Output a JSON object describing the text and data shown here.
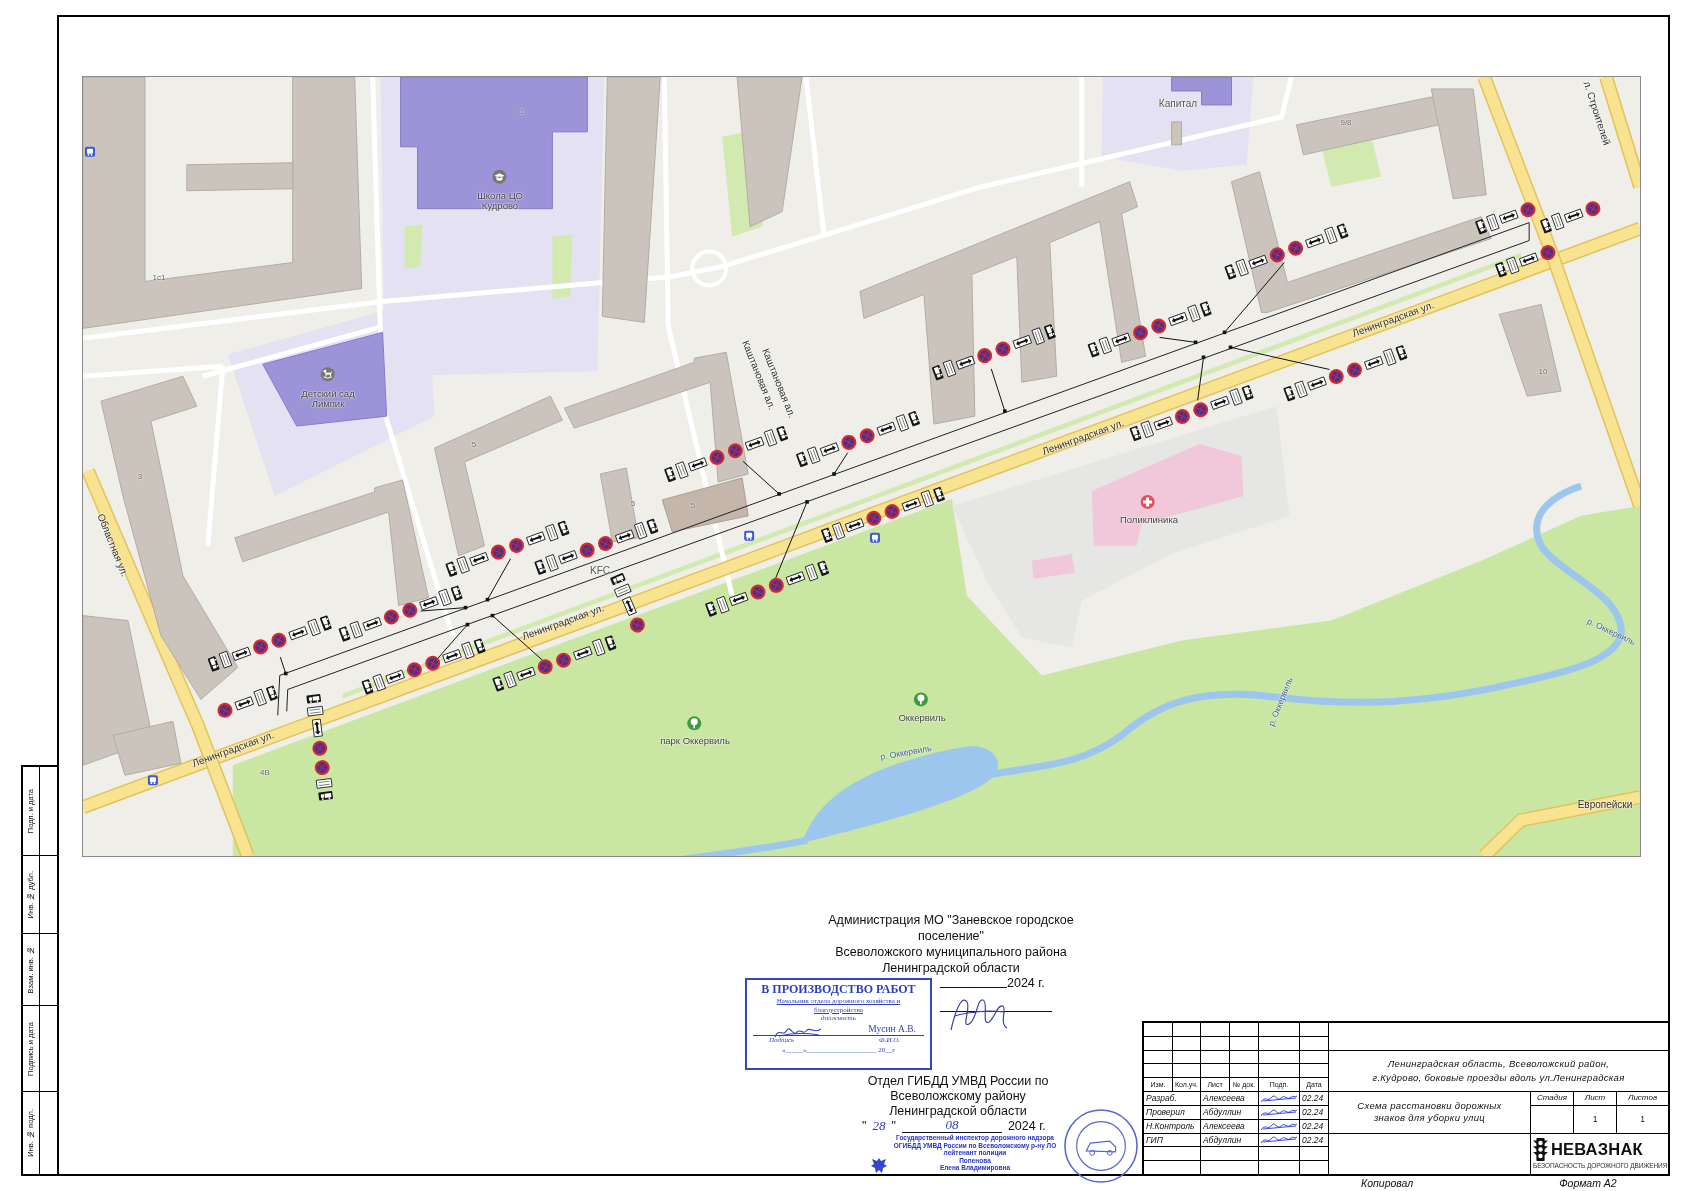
{
  "side_stamp": [
    "Подп. и дата",
    "Инв. № дубл.",
    "Взам. инв. №",
    "Подпись и дата",
    "Инв. № подл."
  ],
  "map": {
    "labels": [
      {
        "kind": "place",
        "text": "Капитал"
      },
      {
        "kind": "number",
        "text": "9/8"
      },
      {
        "kind": "street",
        "text": "л. Строителей"
      },
      {
        "kind": "number",
        "text": "1"
      },
      {
        "kind": "poi",
        "text": "Школа ЦО Кудрово"
      },
      {
        "kind": "number",
        "text": "1с1"
      },
      {
        "kind": "street",
        "text": "Ленинградская ул."
      },
      {
        "kind": "poi",
        "text": "Детский сад Лимпик"
      },
      {
        "kind": "number",
        "text": "10"
      },
      {
        "kind": "street",
        "text": "Каштановая ал."
      },
      {
        "kind": "street",
        "text": "Каштановая ал."
      },
      {
        "kind": "street",
        "text": "Ленинградская ул."
      },
      {
        "kind": "number",
        "text": "5"
      },
      {
        "kind": "number",
        "text": "3"
      },
      {
        "kind": "number",
        "text": "5"
      },
      {
        "kind": "number",
        "text": "5"
      },
      {
        "kind": "poi",
        "text": "Поликлиника"
      },
      {
        "kind": "street",
        "text": "Областная ул."
      },
      {
        "kind": "place",
        "text": "KFC"
      },
      {
        "kind": "street",
        "text": "Ленинградская ул."
      },
      {
        "kind": "water",
        "text": "р. Оккервиль"
      },
      {
        "kind": "water",
        "text": "р. Оккервиль"
      },
      {
        "kind": "poi",
        "text": "Оккервиль"
      },
      {
        "kind": "poi",
        "text": "парк Оккервиль"
      },
      {
        "kind": "water",
        "text": "р. Оккервиль"
      },
      {
        "kind": "street",
        "text": "Ленинградская ул."
      },
      {
        "kind": "number",
        "text": "4В"
      },
      {
        "kind": "street",
        "text": "Европейски"
      }
    ]
  },
  "approvals": {
    "administration": {
      "lines": [
        "Администрация МО \"Заневское городское",
        "поселение\"",
        "Всеволожского муниципального района",
        "Ленинградской области"
      ],
      "year": "2024 г."
    },
    "work_stamp": {
      "title": "В ПРОИЗВОДСТВО РАБОТ",
      "position_lines": [
        "Начальник отдела дорожного хозяйства и",
        "благоустройства"
      ],
      "position_caption": "должность",
      "name": "Мусин А.В.",
      "signature_caption": "Подпись",
      "name_caption": "Ф.И.О.",
      "date_line": "«_____»____________________ 20__г"
    },
    "traffic_police": {
      "lines": [
        "Отдел ГИБДД УМВД России по",
        "Всеволожскому району",
        "Ленинградской области"
      ],
      "date": {
        "quote_open": "\"",
        "day": "28",
        "quote_close": "\"",
        "month": "08",
        "year": "2024 г."
      },
      "inspector_stamp": [
        "Государственный инспектор дорожного надзора",
        "ОГИБДД УМВД России по Всеволожскому р-ну ЛО",
        "лейтенант полиции",
        "Попенова",
        "Елена Владимировна"
      ]
    }
  },
  "title_block": {
    "header": [
      "Изм.",
      "Кол.уч.",
      "Лист",
      "№ док.",
      "Подп.",
      "Дата"
    ],
    "staff": [
      {
        "role": "Разраб.",
        "name": "Алексеева",
        "signed": true,
        "date": "02.24"
      },
      {
        "role": "Проверил",
        "name": "Абдуллин",
        "signed": true,
        "date": "02.24"
      },
      {
        "role": "Н.Контроль",
        "name": "Алексеева",
        "signed": true,
        "date": "02.24"
      },
      {
        "role": "ГИП",
        "name": "Абдуллин",
        "signed": true,
        "date": "02.24"
      }
    ],
    "address_lines": [
      "Ленинградская область, Всеволожский район,",
      "г.Кудрово, боковые проезды вдоль ул.Ленинградская"
    ],
    "title_lines": [
      "Схема расстановки дорожных",
      "знаков для уборки улиц"
    ],
    "sheet": [
      {
        "label": "Стадия"
      },
      {
        "label": "Лист",
        "value": "1"
      },
      {
        "label": "Листов",
        "value": "1"
      }
    ],
    "logo": {
      "name": "НЕВАЗНАК",
      "tagline": "БЕЗОПАСНОСТЬ ДОРОЖНОГО ДВИЖЕНИЯ"
    }
  },
  "footer": {
    "copied": "Копировал",
    "format": "Формат А2"
  }
}
